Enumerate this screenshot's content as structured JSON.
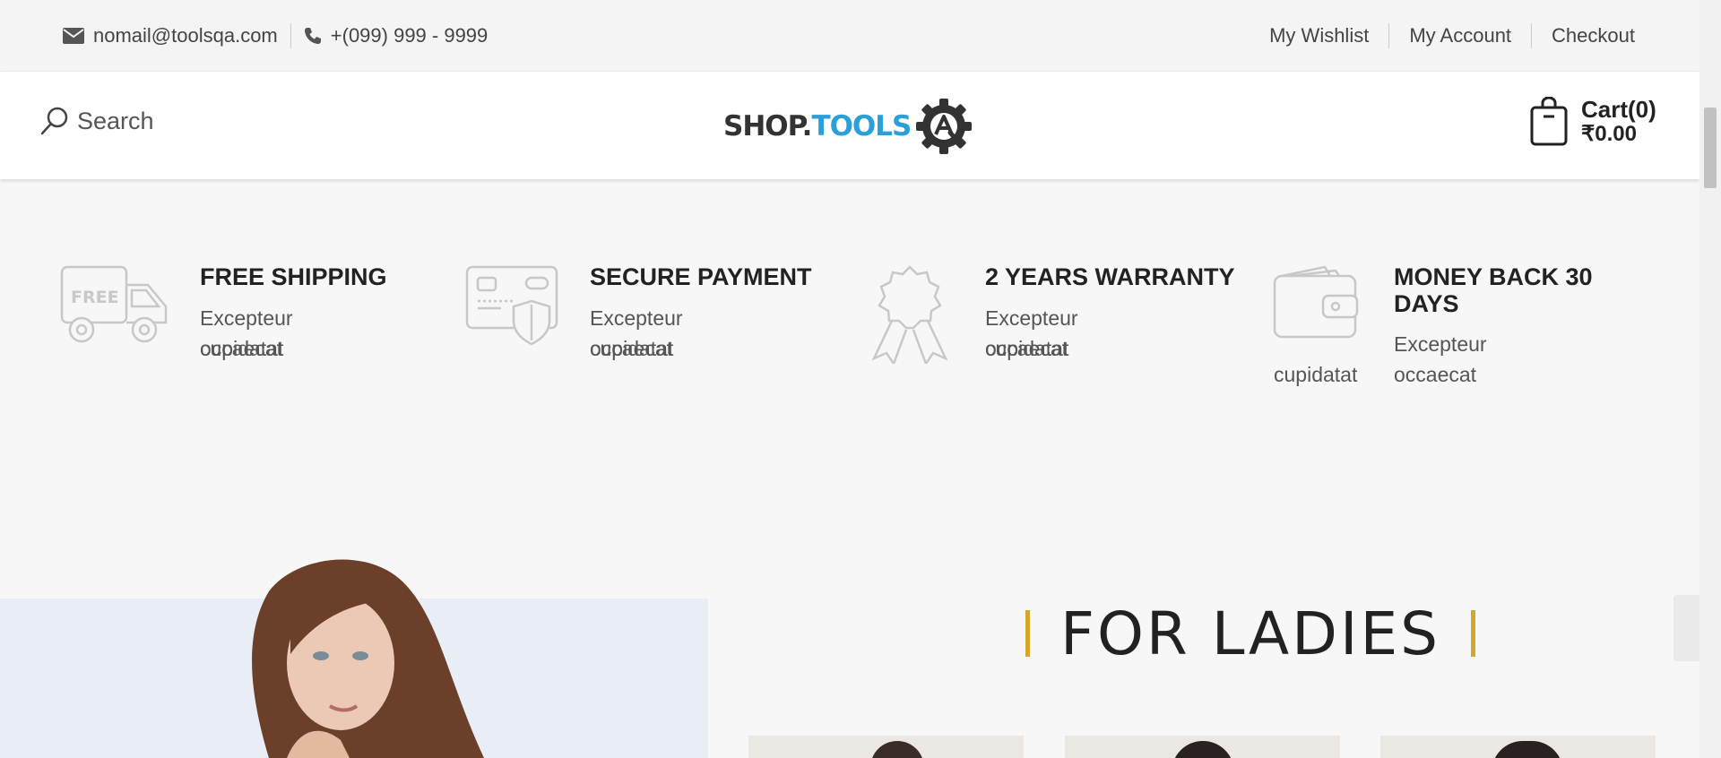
{
  "topbar": {
    "email": "nomail@toolsqa.com",
    "phone": "+(099) 999 - 9999",
    "links": [
      "My Wishlist",
      "My Account",
      "Checkout"
    ]
  },
  "header": {
    "search_label": "Search",
    "logo_text_dark": "SHOP.",
    "logo_text_blue": "TOOLS",
    "cart_count": "Cart(0)",
    "cart_total": "₹0.00"
  },
  "features": [
    {
      "title": "FREE SHIPPING",
      "desc_line1": "Excepteur occaecat",
      "desc_line2": "cupidatat",
      "icon": "truck-icon"
    },
    {
      "title": "SECURE PAYMENT",
      "desc_line1": "Excepteur occaecat",
      "desc_line2": "cupidatat",
      "icon": "card-shield-icon"
    },
    {
      "title": "2 YEARS WARRANTY",
      "desc_line1": "Excepteur occaecat",
      "desc_line2": "cupidatat",
      "icon": "award-ribbon-icon"
    },
    {
      "title_line1": "MONEY BACK 30",
      "title_line2": "DAYS",
      "desc_line1": "Excepteur occaecat",
      "desc_line2": "cupidatat",
      "icon": "wallet-icon"
    }
  ],
  "ladies": {
    "title": "FOR LADIES"
  },
  "colors": {
    "accent": "#d4a72c",
    "logo_blue": "#2a9fd8",
    "icon_gray": "#c8c8c8"
  }
}
